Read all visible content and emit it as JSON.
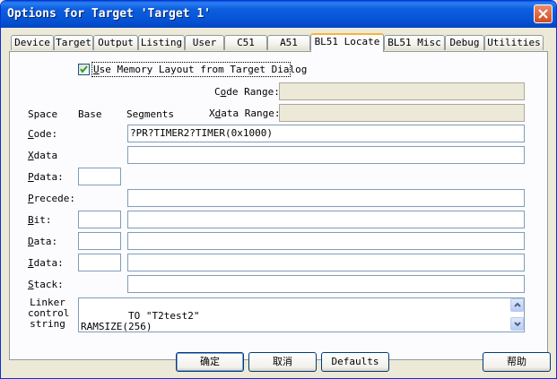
{
  "window": {
    "title": "Options for Target 'Target 1'",
    "close_icon": "close-icon"
  },
  "tabs": [
    {
      "label": "Device"
    },
    {
      "label": "Target"
    },
    {
      "label": "Output"
    },
    {
      "label": "Listing"
    },
    {
      "label": "User"
    },
    {
      "label": "C51"
    },
    {
      "label": "A51"
    },
    {
      "label": "BL51 Locate",
      "active": true
    },
    {
      "label": "BL51 Misc"
    },
    {
      "label": "Debug"
    },
    {
      "label": "Utilities"
    }
  ],
  "locate": {
    "use_memory_layout": {
      "checked": true,
      "label_pre": "",
      "label_hot": "U",
      "label_post": "se Memory Layout from Target Dialog"
    },
    "code_range": {
      "label_pre": "C",
      "label_hot": "o",
      "label_post": "de Range:",
      "value": ""
    },
    "xdata_range": {
      "label_pre": "X",
      "label_hot": "d",
      "label_post": "ata Range:",
      "value": ""
    },
    "headers": {
      "space": "Space",
      "base": "Base",
      "segments": "Segments"
    },
    "code": {
      "hot": "C",
      "rest": "ode:",
      "segments": "?PR?TIMER2?TIMER(0x1000)"
    },
    "xdata": {
      "hot": "X",
      "rest": "data",
      "segments": ""
    },
    "pdata": {
      "hot": "P",
      "rest": "data:",
      "base": ""
    },
    "precede": {
      "hot": "P",
      "rest": "recede:",
      "segments": ""
    },
    "bit": {
      "hot": "B",
      "rest": "it:",
      "base": "",
      "segments": ""
    },
    "data": {
      "hot": "D",
      "rest": "ata:",
      "base": "",
      "segments": ""
    },
    "idata": {
      "hot": "I",
      "rest": "data:",
      "base": "",
      "segments": ""
    },
    "stack": {
      "hot": "S",
      "rest": "tack:",
      "segments": ""
    },
    "linker": {
      "label_line1": "Linker",
      "label_line2": "control",
      "label_line3": "string",
      "text": "TO \"T2test2\"\nRAMSIZE(256)"
    }
  },
  "buttons": {
    "ok": "确定",
    "cancel": "取消",
    "defaults": "Defaults",
    "help": "帮助"
  },
  "colors": {
    "titlebar": "#0554d6",
    "close_button": "#d04c24",
    "active_tab_highlight": "#f7b33d"
  }
}
